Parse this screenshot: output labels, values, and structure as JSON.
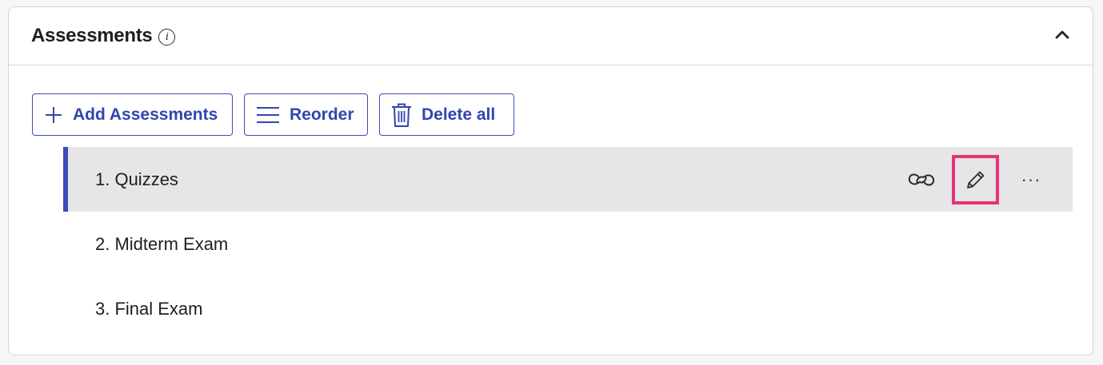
{
  "panel": {
    "title": "Assessments",
    "info_glyph": "i",
    "collapse_icon": "chevron-up-icon"
  },
  "toolbar": {
    "add_label": "Add Assessments",
    "reorder_label": "Reorder",
    "delete_label": "Delete all"
  },
  "assessments": [
    {
      "label": "1. Quizzes",
      "selected": true
    },
    {
      "label": "2. Midterm Exam",
      "selected": false
    },
    {
      "label": "3. Final Exam",
      "selected": false
    }
  ],
  "row_actions": {
    "more_glyph": "···"
  },
  "colors": {
    "accent": "#3a4cb5",
    "highlight": "#e8317a",
    "selected_row_bg": "#e6e6e6"
  }
}
